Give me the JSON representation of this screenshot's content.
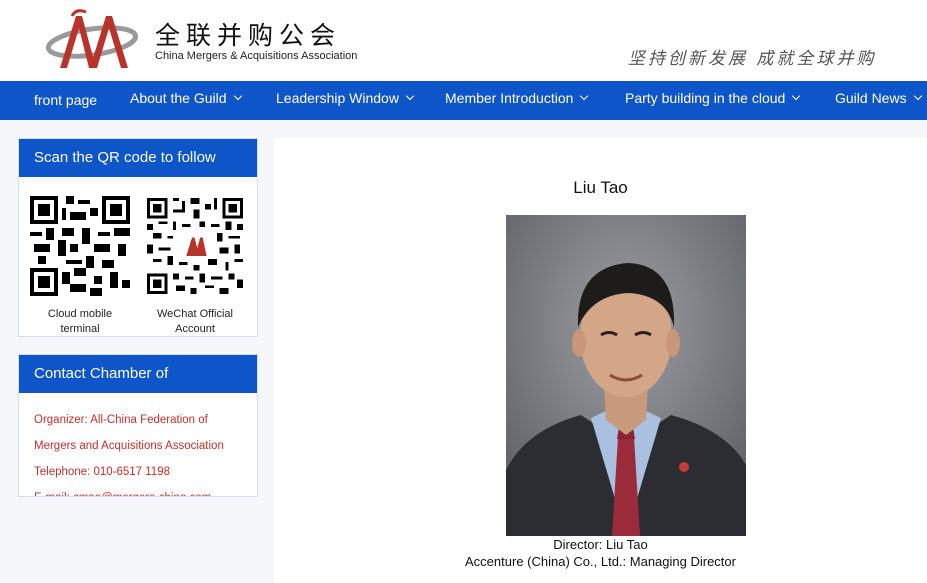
{
  "header": {
    "org_name_cn": "全联并购公会",
    "org_name_en": "China Mergers & Acquisitions Association",
    "slogan": "坚持创新发展 成就全球并购"
  },
  "nav": {
    "items": [
      {
        "label": "front page",
        "has_dropdown": false
      },
      {
        "label": "About the Guild",
        "has_dropdown": true
      },
      {
        "label": "Leadership Window",
        "has_dropdown": true
      },
      {
        "label": "Member Introduction",
        "has_dropdown": true
      },
      {
        "label": "Party building in the cloud",
        "has_dropdown": true
      },
      {
        "label": "Guild News",
        "has_dropdown": true
      }
    ]
  },
  "qr_panel": {
    "title": "Scan the QR code to follow",
    "codes": [
      {
        "caption_line1": "Cloud mobile",
        "caption_line2": "terminal"
      },
      {
        "caption_line1": "WeChat Official",
        "caption_line2": "Account"
      }
    ]
  },
  "contact_panel": {
    "title": "Contact Chamber of",
    "lines": [
      "Organizer: All-China Federation of",
      "Mergers and Acquisitions Association",
      "Telephone: 010-6517 1198",
      "E-mail: cmaa@mergers-china.com"
    ]
  },
  "profile": {
    "name": "Liu Tao",
    "caption_line1": "Director: Liu Tao",
    "caption_line2": "Accenture (China) Co., Ltd.: Managing Director"
  },
  "colors": {
    "brand_blue": "#0d55c9",
    "logo_red": "#b8332a",
    "contact_red": "#c0302b"
  }
}
